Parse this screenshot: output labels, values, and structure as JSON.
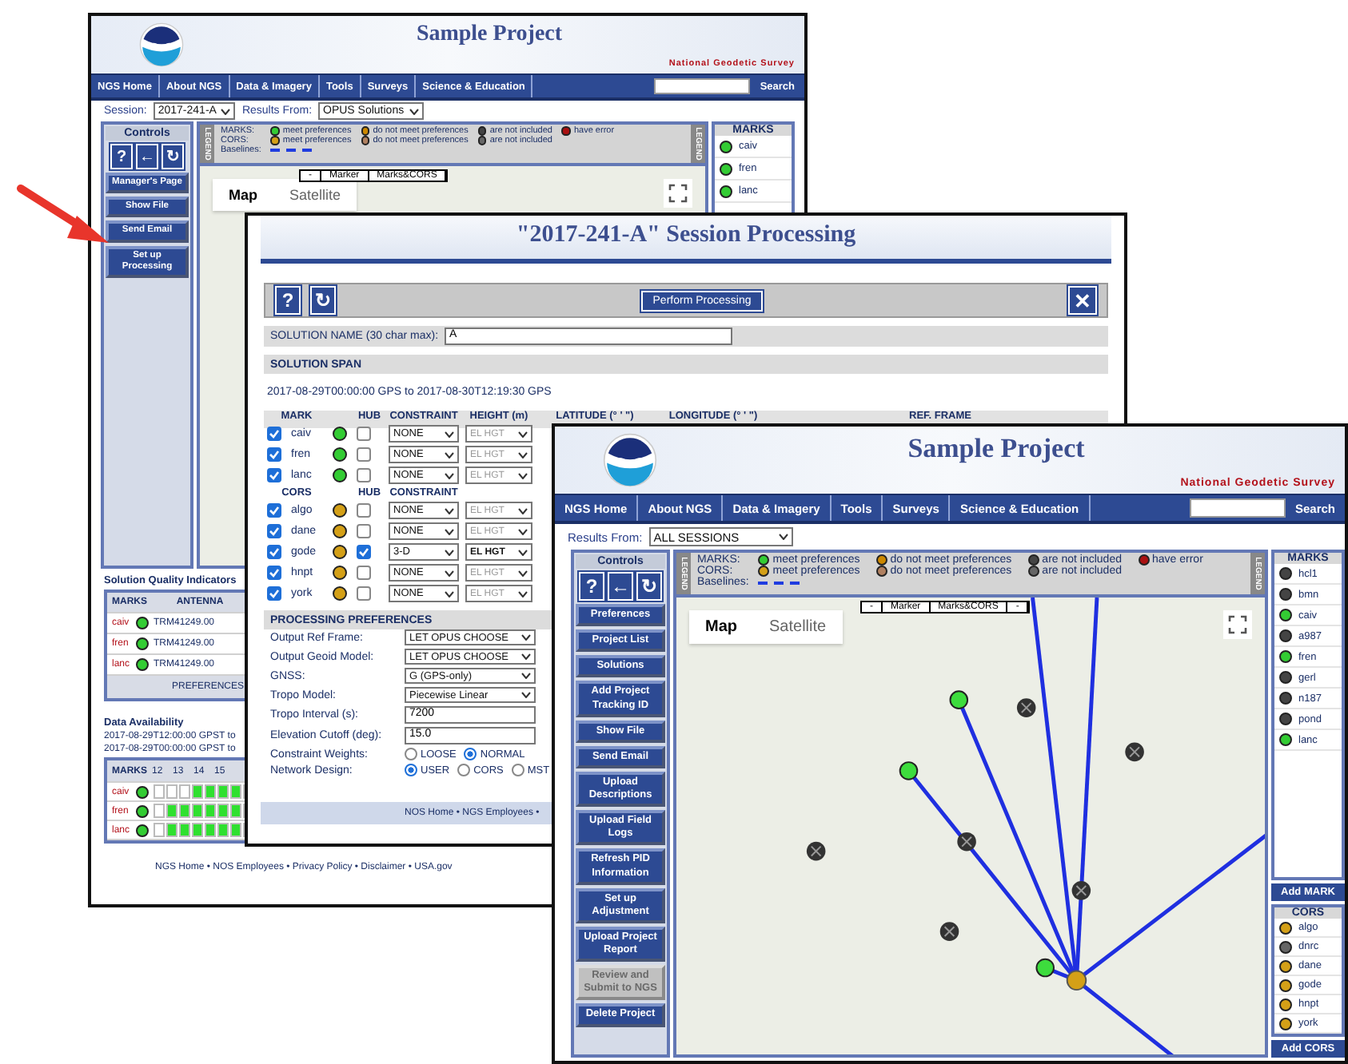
{
  "back_window": {
    "header": {
      "title": "Sample Project",
      "agency": "National Geodetic Survey"
    },
    "nav": {
      "items": [
        "NGS Home",
        "About NGS",
        "Data & Imagery",
        "Tools",
        "Surveys",
        "Science & Education"
      ],
      "search_button": "Search"
    },
    "session": {
      "label": "Session:",
      "value": "2017-241-A",
      "results_label": "Results From:",
      "results_value": "OPUS Solutions"
    },
    "controls": {
      "title": "Controls",
      "icon_buttons": [
        "?",
        "←",
        "↻"
      ],
      "buttons": [
        {
          "label": "Manager's Page",
          "disabled": false
        },
        {
          "label": "Show File",
          "disabled": false
        },
        {
          "label": "Send Email",
          "disabled": false
        },
        {
          "label": "Set up Processing",
          "disabled": false
        }
      ]
    },
    "legend_tabs": [
      "LEGEND",
      "LEGEND"
    ],
    "legend": {
      "groups": [
        {
          "label": "MARKS:",
          "items": [
            {
              "text": "meet preferences",
              "color": "#33cc33"
            },
            {
              "text": "do not meet preferences",
              "color": "#cc8800"
            },
            {
              "text": "are not included",
              "color": "#444444"
            },
            {
              "text": "have error",
              "color": "#aa1111"
            }
          ]
        },
        {
          "label": "CORS:",
          "items": [
            {
              "text": "meet preferences",
              "color": "#d4a017"
            },
            {
              "text": "do not meet preferences",
              "color": "#b08060"
            },
            {
              "text": "are not included",
              "color": "#666666"
            }
          ]
        }
      ],
      "baselines_label": "Baselines:"
    },
    "map_tabs": [
      {
        "label": "Map",
        "selected": true
      },
      {
        "label": "Satellite",
        "selected": false
      }
    ],
    "map_toolbar": [
      "-",
      "Marker",
      "Marks&CORS"
    ],
    "marks_panel": {
      "title": "MARKS",
      "items": [
        {
          "name": "caiv",
          "color": "#33cc33"
        },
        {
          "name": "fren",
          "color": "#33cc33"
        },
        {
          "name": "lanc",
          "color": "#33cc33"
        }
      ]
    },
    "quality": {
      "title": "Solution Quality Indicators",
      "columns": [
        "MARKS",
        "ANTENNA"
      ],
      "rows": [
        {
          "mark": "caiv",
          "color": "#33cc33",
          "antenna": "TRM41249.00"
        },
        {
          "mark": "fren",
          "color": "#33cc33",
          "antenna": "TRM41249.00"
        },
        {
          "mark": "lanc",
          "color": "#33cc33",
          "antenna": "TRM41249.00"
        }
      ],
      "button": "PREFERENCES"
    },
    "availability": {
      "title": "Data Availability",
      "spans": [
        "2017-08-29T12:00:00 GPST to",
        "2017-08-29T00:00:00 GPST to"
      ],
      "columns": [
        "MARKS",
        "12",
        "13",
        "14",
        "15"
      ],
      "rows": [
        {
          "mark": "caiv",
          "color": "#33cc33"
        },
        {
          "mark": "fren",
          "color": "#33cc33"
        },
        {
          "mark": "lanc",
          "color": "#33cc33"
        }
      ]
    },
    "footer": "NGS Home • NOS Employees • Privacy Policy • Disclaimer • USA.gov"
  },
  "session_dialog": {
    "title": "\"2017-241-A\" Session Processing",
    "toolbar": {
      "icon_buttons": [
        "?",
        "↻"
      ],
      "action": "Perform Processing",
      "close": "✕"
    },
    "solution_name": {
      "label": "SOLUTION NAME (30 char max):",
      "value": "A"
    },
    "span": {
      "title": "SOLUTION SPAN",
      "value": "2017-08-29T00:00:00 GPS  to  2017-08-30T12:19:30 GPS"
    },
    "marks_table": {
      "columns": [
        "MARK",
        "HUB",
        "CONSTRAINT",
        "HEIGHT (m)",
        "LATITUDE (° ' \")",
        "LONGITUDE (° ' \")",
        "REF. FRAME"
      ],
      "rows": [
        {
          "checked": true,
          "mark": "caiv",
          "color": "#33cc33",
          "hub": false,
          "constraint": "NONE",
          "height": "EL HGT",
          "height_enabled": false
        },
        {
          "checked": true,
          "mark": "fren",
          "color": "#33cc33",
          "hub": false,
          "constraint": "NONE",
          "height": "EL HGT",
          "height_enabled": false
        },
        {
          "checked": true,
          "mark": "lanc",
          "color": "#33cc33",
          "hub": false,
          "constraint": "NONE",
          "height": "EL HGT",
          "height_enabled": false
        }
      ]
    },
    "cors_table": {
      "columns": [
        "CORS",
        "HUB",
        "CONSTRAINT"
      ],
      "rows": [
        {
          "checked": true,
          "mark": "algo",
          "color": "#d4a017",
          "hub": false,
          "constraint": "NONE",
          "height": "EL HGT",
          "height_enabled": false
        },
        {
          "checked": true,
          "mark": "dane",
          "color": "#d4a017",
          "hub": false,
          "constraint": "NONE",
          "height": "EL HGT",
          "height_enabled": false
        },
        {
          "checked": true,
          "mark": "gode",
          "color": "#d4a017",
          "hub": true,
          "constraint": "3-D",
          "height": "EL HGT",
          "height_enabled": true
        },
        {
          "checked": true,
          "mark": "hnpt",
          "color": "#d4a017",
          "hub": false,
          "constraint": "NONE",
          "height": "EL HGT",
          "height_enabled": false
        },
        {
          "checked": true,
          "mark": "york",
          "color": "#d4a017",
          "hub": false,
          "constraint": "NONE",
          "height": "EL HGT",
          "height_enabled": false
        }
      ]
    },
    "preferences": {
      "title": "PROCESSING PREFERENCES",
      "fields": [
        {
          "kind": "select",
          "label": "Output Ref Frame:",
          "value": "LET OPUS CHOOSE"
        },
        {
          "kind": "select",
          "label": "Output Geoid Model:",
          "value": "LET OPUS CHOOSE"
        },
        {
          "kind": "select",
          "label": "GNSS:",
          "value": "G (GPS-only)"
        },
        {
          "kind": "select",
          "label": "Tropo Model:",
          "value": "Piecewise Linear"
        },
        {
          "kind": "input",
          "label": "Tropo Interval (s):",
          "value": "7200"
        },
        {
          "kind": "input",
          "label": "Elevation Cutoff (deg):",
          "value": "15.0"
        },
        {
          "kind": "radio",
          "label": "Constraint Weights:",
          "options": [
            {
              "label": "LOOSE",
              "selected": false
            },
            {
              "label": "NORMAL",
              "selected": true
            }
          ]
        },
        {
          "kind": "radio",
          "label": "Network Design:",
          "options": [
            {
              "label": "USER",
              "selected": true
            },
            {
              "label": "CORS",
              "selected": false
            },
            {
              "label": "MST",
              "selected": false
            }
          ]
        }
      ]
    },
    "footer": "NOS Home • NGS Employees •"
  },
  "front_window": {
    "header": {
      "title": "Sample Project",
      "agency": "National Geodetic Survey"
    },
    "nav": {
      "items": [
        "NGS Home",
        "About NGS",
        "Data & Imagery",
        "Tools",
        "Surveys",
        "Science & Education"
      ],
      "search_button": "Search"
    },
    "results": {
      "label": "Results From:",
      "value": "ALL SESSIONS"
    },
    "controls": {
      "title": "Controls",
      "icon_buttons": [
        "?",
        "←",
        "↻"
      ],
      "buttons": [
        {
          "label": "Preferences",
          "disabled": false
        },
        {
          "label": "Project List",
          "disabled": false
        },
        {
          "label": "Solutions",
          "disabled": false
        },
        {
          "label": "Add Project Tracking ID",
          "disabled": false
        },
        {
          "label": "Show File",
          "disabled": false
        },
        {
          "label": "Send Email",
          "disabled": false
        },
        {
          "label": "Upload Descriptions",
          "disabled": false
        },
        {
          "label": "Upload Field Logs",
          "disabled": false
        },
        {
          "label": "Refresh PID Information",
          "disabled": false
        },
        {
          "label": "Set up Adjustment",
          "disabled": false
        },
        {
          "label": "Upload Project Report",
          "disabled": false
        },
        {
          "label": "Review and Submit to NGS",
          "disabled": true
        },
        {
          "label": "Delete Project",
          "disabled": false
        }
      ]
    },
    "legend_tabs": [
      "LEGEND",
      "LEGEND"
    ],
    "legend": {
      "groups": [
        {
          "label": "MARKS:",
          "items": [
            {
              "text": "meet preferences",
              "color": "#33cc33"
            },
            {
              "text": "do not meet preferences",
              "color": "#cc8800"
            },
            {
              "text": "are not included",
              "color": "#444444"
            },
            {
              "text": "have error",
              "color": "#aa1111"
            }
          ]
        },
        {
          "label": "CORS:",
          "items": [
            {
              "text": "meet preferences",
              "color": "#d4a017"
            },
            {
              "text": "do not meet preferences",
              "color": "#b08060"
            },
            {
              "text": "are not included",
              "color": "#666666"
            }
          ]
        }
      ],
      "baselines_label": "Baselines:"
    },
    "map_tabs": [
      {
        "label": "Map",
        "selected": true
      },
      {
        "label": "Satellite",
        "selected": false
      }
    ],
    "map_toolbar": [
      "-",
      "Marker",
      "Marks&CORS",
      "-"
    ],
    "marks_panel": {
      "title": "MARKS",
      "items": [
        {
          "name": "hcl1",
          "color": "#444444"
        },
        {
          "name": "bmn",
          "color": "#444444"
        },
        {
          "name": "caiv",
          "color": "#33cc33"
        },
        {
          "name": "a987",
          "color": "#444444"
        },
        {
          "name": "fren",
          "color": "#33cc33"
        },
        {
          "name": "gerl",
          "color": "#444444"
        },
        {
          "name": "n187",
          "color": "#444444"
        },
        {
          "name": "pond",
          "color": "#444444"
        },
        {
          "name": "lanc",
          "color": "#33cc33"
        }
      ],
      "add_button": "Add MARK"
    },
    "cors_panel": {
      "title": "CORS",
      "items": [
        {
          "name": "algo",
          "color": "#d4a017"
        },
        {
          "name": "dnrc",
          "color": "#666666"
        },
        {
          "name": "dane",
          "color": "#d4a017"
        },
        {
          "name": "gode",
          "color": "#d4a017"
        },
        {
          "name": "hnpt",
          "color": "#d4a017"
        },
        {
          "name": "york",
          "color": "#d4a017"
        }
      ],
      "add_button": "Add CORS"
    }
  }
}
